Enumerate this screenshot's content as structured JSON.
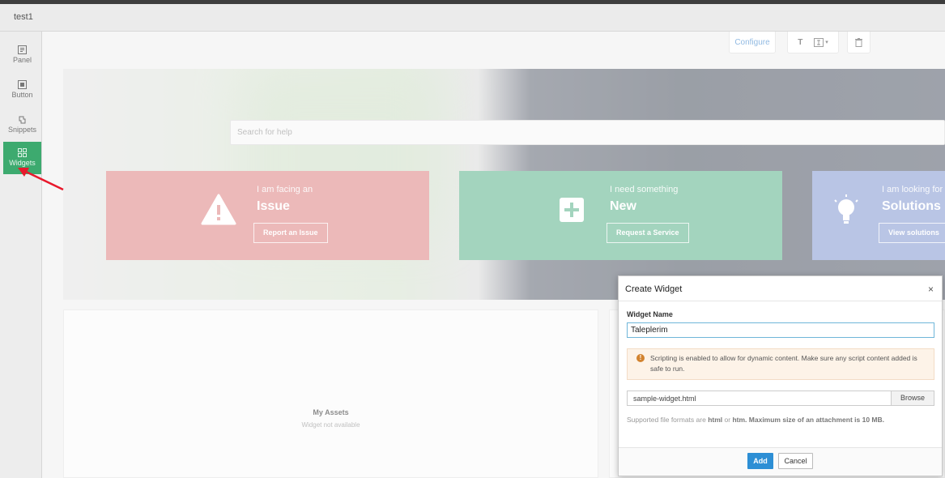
{
  "app": {
    "title": "test1"
  },
  "sidebar": {
    "items": [
      {
        "label": "Panel",
        "icon": "panel-icon"
      },
      {
        "label": "Button",
        "icon": "button-icon"
      },
      {
        "label": "Snippets",
        "icon": "snippets-icon"
      },
      {
        "label": "Widgets",
        "icon": "widgets-icon",
        "active": true
      }
    ]
  },
  "toolbar": {
    "configure_label": "Configure",
    "text_label": "T"
  },
  "search": {
    "placeholder": "Search for help"
  },
  "cards": [
    {
      "subtitle": "I am facing an",
      "title": "Issue",
      "button": "Report an Issue",
      "color": "#e08f8f"
    },
    {
      "subtitle": "I need something",
      "title": "New",
      "button": "Request a Service",
      "color": "#6bba97"
    },
    {
      "subtitle": "I am looking for",
      "title": "Solutions",
      "button": "View solutions",
      "color": "#8fa2d6"
    }
  ],
  "assets": {
    "title": "My Assets",
    "subtitle": "Widget not available"
  },
  "dialog": {
    "title": "Create Widget",
    "close": "×",
    "name_label": "Widget Name",
    "name_value": "Taleplerim",
    "warning": "Scripting is enabled to allow for dynamic content. Make sure any script content added is safe to run.",
    "file_name": "sample-widget.html",
    "browse_label": "Browse",
    "formats_prefix": "Supported file formats are",
    "format_html": "html",
    "formats_or": "or",
    "format_htm": "htm.",
    "formats_max": "Maximum size of an attachment is 10 MB.",
    "add_label": "Add",
    "cancel_label": "Cancel"
  },
  "colors": {
    "accent": "#2d8fd5",
    "sidebar_active": "#3daa6f",
    "annotation_arrow": "#e8192c"
  }
}
